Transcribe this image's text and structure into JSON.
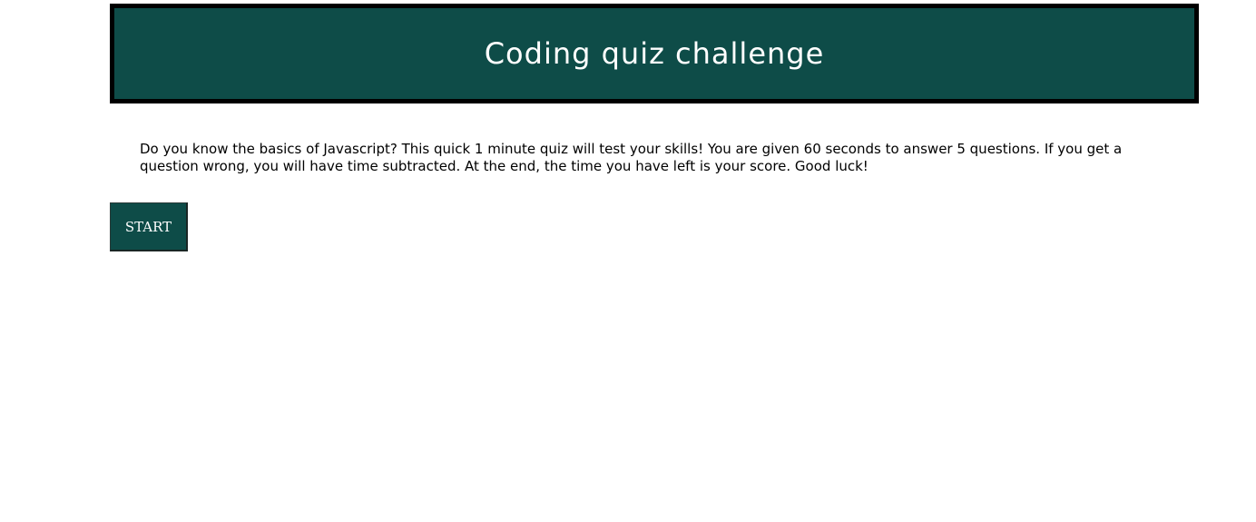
{
  "colors": {
    "primary": "#0e4c48",
    "text_light": "#ffffff",
    "border": "#000000"
  },
  "header": {
    "title": "Coding quiz challenge"
  },
  "intro": {
    "text": "Do you know the basics of Javascript? This quick 1 minute quiz will test your skills! You are given 60 seconds to answer 5 questions. If you get a question wrong, you will have time subtracted. At the end, the time you have left is your score. Good luck!"
  },
  "actions": {
    "start_label": "START"
  }
}
